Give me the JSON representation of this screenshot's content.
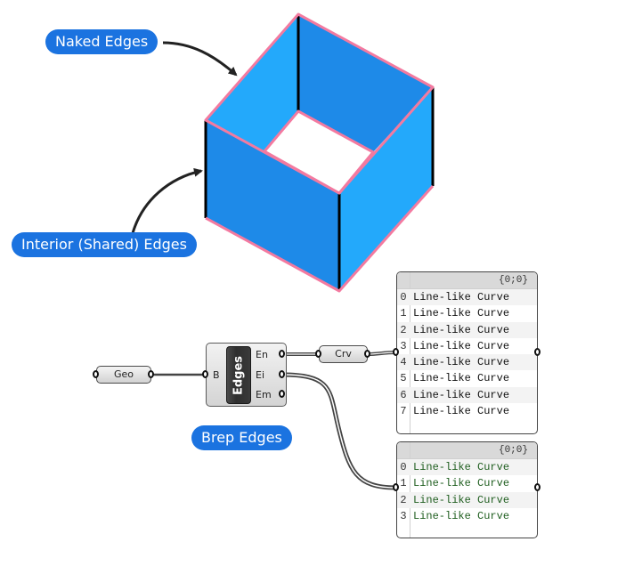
{
  "callouts": {
    "naked": "Naked Edges",
    "interior": "Interior (Shared) Edges",
    "brep": "Brep Edges"
  },
  "colors": {
    "callout_bg": "#1b73e0",
    "face_light": "#23a9fb",
    "face_dark": "#1e8ae8",
    "naked_edge": "#f37aa0",
    "interior_edge": "#000000"
  },
  "definition": {
    "geo_param": "Geo",
    "component": {
      "nickname": "Edges",
      "input": "B",
      "outputs": [
        "En",
        "Ei",
        "Em"
      ]
    },
    "crv_param": "Crv"
  },
  "panels": [
    {
      "path": "{0;0}",
      "rows": [
        {
          "index": "0",
          "value": "Line-like Curve"
        },
        {
          "index": "1",
          "value": "Line-like Curve"
        },
        {
          "index": "2",
          "value": "Line-like Curve"
        },
        {
          "index": "3",
          "value": "Line-like Curve"
        },
        {
          "index": "4",
          "value": "Line-like Curve"
        },
        {
          "index": "5",
          "value": "Line-like Curve"
        },
        {
          "index": "6",
          "value": "Line-like Curve"
        },
        {
          "index": "7",
          "value": "Line-like Curve"
        }
      ]
    },
    {
      "path": "{0;0}",
      "rows": [
        {
          "index": "0",
          "value": "Line-like Curve"
        },
        {
          "index": "1",
          "value": "Line-like Curve"
        },
        {
          "index": "2",
          "value": "Line-like Curve"
        },
        {
          "index": "3",
          "value": "Line-like Curve"
        }
      ]
    }
  ]
}
